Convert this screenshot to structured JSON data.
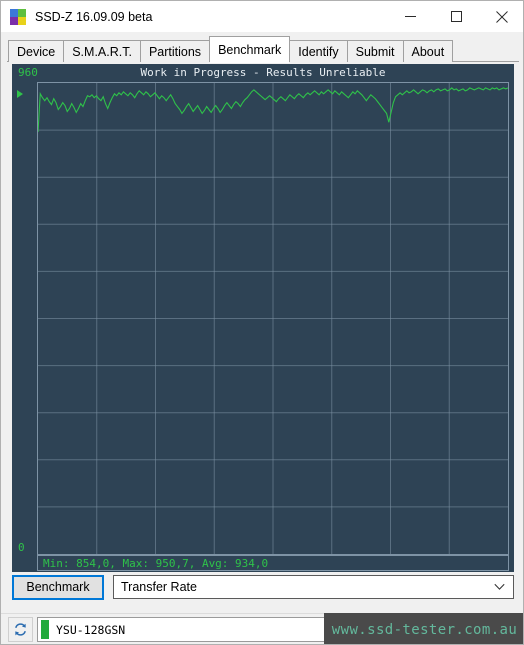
{
  "window": {
    "title": "SSD-Z 16.09.09 beta",
    "icon": "app-logo-icon",
    "icon_colors": [
      "#3b78d8",
      "#5fbf3f",
      "#7b2fa8",
      "#e8d21a"
    ],
    "controls": {
      "minimize": "minimize-icon",
      "maximize": "maximize-icon",
      "close": "close-icon"
    }
  },
  "tabs": [
    {
      "label": "Device",
      "active": false
    },
    {
      "label": "S.M.A.R.T.",
      "active": false
    },
    {
      "label": "Partitions",
      "active": false
    },
    {
      "label": "Benchmark",
      "active": true
    },
    {
      "label": "Identify",
      "active": false
    },
    {
      "label": "Submit",
      "active": false
    },
    {
      "label": "About",
      "active": false
    }
  ],
  "benchmark": {
    "panel_title": "Work in Progress - Results Unreliable",
    "axis_max": "960",
    "axis_min": "0",
    "stats": "Min: 854,0, Max: 950,7, Avg: 934,0",
    "colors": {
      "panel_background": "#2e4355",
      "grid": "#7e93a5",
      "trace": "#2fc24a",
      "title": "#e8eef2"
    }
  },
  "controls": {
    "benchmark_button": "Benchmark",
    "mode_select_value": "Transfer Rate",
    "mode_select_options": [
      "Transfer Rate"
    ],
    "chevron": "chevron-down-icon"
  },
  "status": {
    "refresh_icon": "refresh-icon",
    "drive_name": "YSU-128GSN",
    "health_color": "#22aa3c"
  },
  "watermark": {
    "text": "www.ssd-tester.com.au"
  },
  "chart_data": {
    "type": "line",
    "title": "Work in Progress - Results Unreliable",
    "xlabel": "",
    "ylabel": "",
    "ylim": [
      0,
      960
    ],
    "grid": true,
    "grid_rows": 10,
    "grid_cols": 8,
    "legend": null,
    "stats": {
      "min": 854.0,
      "max": 950.7,
      "avg": 934.0
    },
    "series": [
      {
        "name": "Transfer Rate",
        "color": "#2fc24a",
        "values": [
          860,
          938,
          930,
          924,
          930,
          922,
          916,
          928,
          920,
          906,
          912,
          920,
          914,
          902,
          908,
          918,
          910,
          900,
          908,
          918,
          912,
          924,
          934,
          932,
          936,
          930,
          934,
          928,
          924,
          932,
          918,
          908,
          920,
          930,
          938,
          934,
          940,
          936,
          942,
          938,
          934,
          940,
          936,
          930,
          938,
          944,
          940,
          936,
          942,
          938,
          932,
          936,
          940,
          934,
          928,
          934,
          930,
          924,
          930,
          936,
          928,
          918,
          912,
          906,
          898,
          904,
          912,
          918,
          910,
          902,
          908,
          914,
          906,
          898,
          904,
          912,
          906,
          900,
          908,
          914,
          908,
          900,
          906,
          914,
          920,
          914,
          908,
          916,
          922,
          918,
          912,
          920,
          926,
          930,
          936,
          942,
          946,
          942,
          938,
          934,
          930,
          926,
          930,
          934,
          930,
          926,
          922,
          928,
          932,
          928,
          924,
          930,
          936,
          932,
          928,
          934,
          938,
          934,
          930,
          936,
          940,
          936,
          940,
          944,
          940,
          936,
          942,
          938,
          942,
          946,
          942,
          938,
          944,
          940,
          936,
          942,
          938,
          934,
          930,
          936,
          942,
          938,
          944,
          940,
          936,
          930,
          924,
          930,
          936,
          932,
          928,
          922,
          916,
          910,
          904,
          898,
          880,
          900,
          920,
          932,
          936,
          940,
          936,
          940,
          944,
          940,
          942,
          946,
          942,
          938,
          942,
          946,
          944,
          940,
          944,
          946,
          942,
          946,
          948,
          944,
          946,
          948,
          944,
          946,
          950,
          946,
          948,
          944,
          946,
          948,
          944,
          946,
          950,
          948,
          946,
          948,
          950,
          948,
          946,
          950,
          948,
          946,
          950,
          948,
          950,
          946,
          948,
          950,
          948,
          950
        ]
      }
    ]
  }
}
